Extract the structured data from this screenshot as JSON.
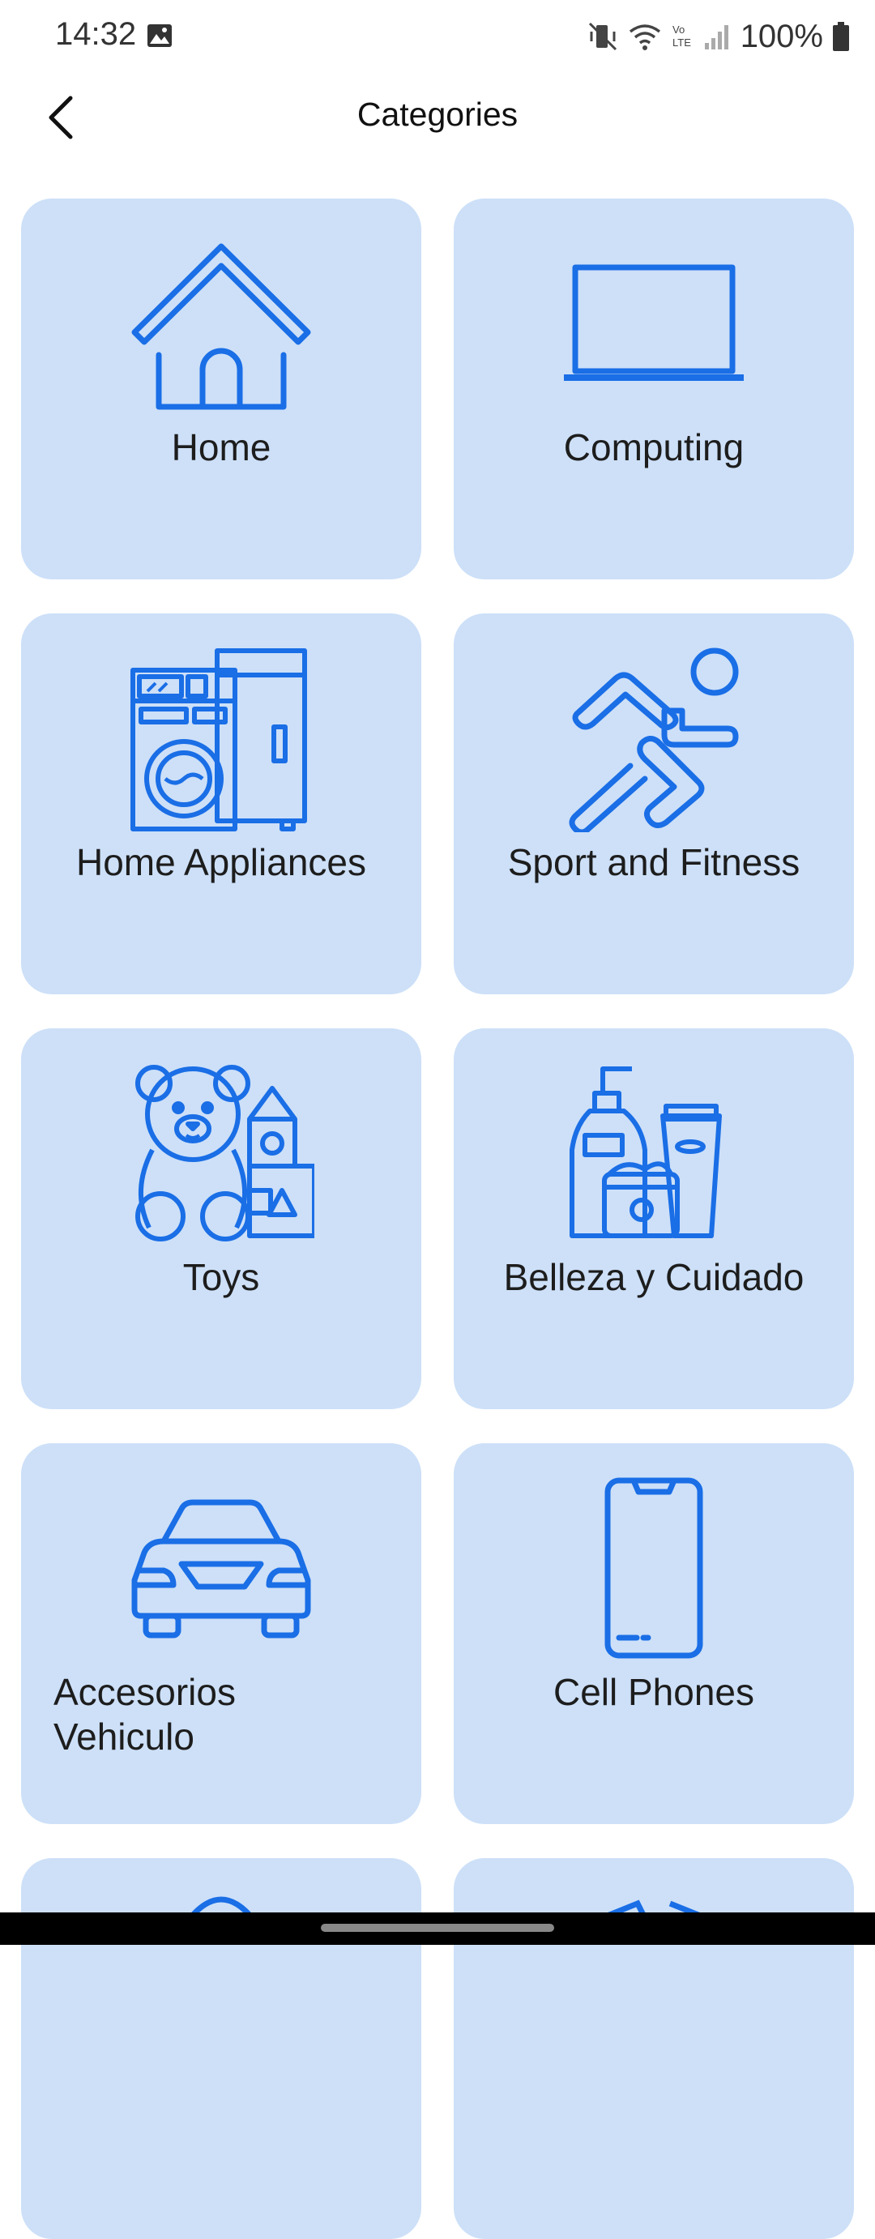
{
  "status": {
    "time": "14:32",
    "battery": "100%",
    "icons": [
      "image-icon",
      "vibrate-icon",
      "wifi-icon",
      "volte-icon",
      "signal-icon",
      "battery-icon"
    ]
  },
  "appbar": {
    "title": "Categories",
    "back_icon": "chevron-left-icon"
  },
  "accent": "#1a6ee6",
  "tile_bg": "#cde0f8",
  "categories": [
    {
      "label": "Home",
      "icon": "house-icon"
    },
    {
      "label": "Computing",
      "icon": "laptop-icon"
    },
    {
      "label": "Home Appliances",
      "icon": "appliances-icon"
    },
    {
      "label": "Sport and Fitness",
      "icon": "runner-icon"
    },
    {
      "label": "Toys",
      "icon": "teddy-bear-icon"
    },
    {
      "label": "Belleza y Cuidado",
      "icon": "cosmetics-icon"
    },
    {
      "label": "Accesorios\nVehiculo",
      "icon": "car-icon"
    },
    {
      "label": "Cell Phones",
      "icon": "phone-icon"
    }
  ]
}
